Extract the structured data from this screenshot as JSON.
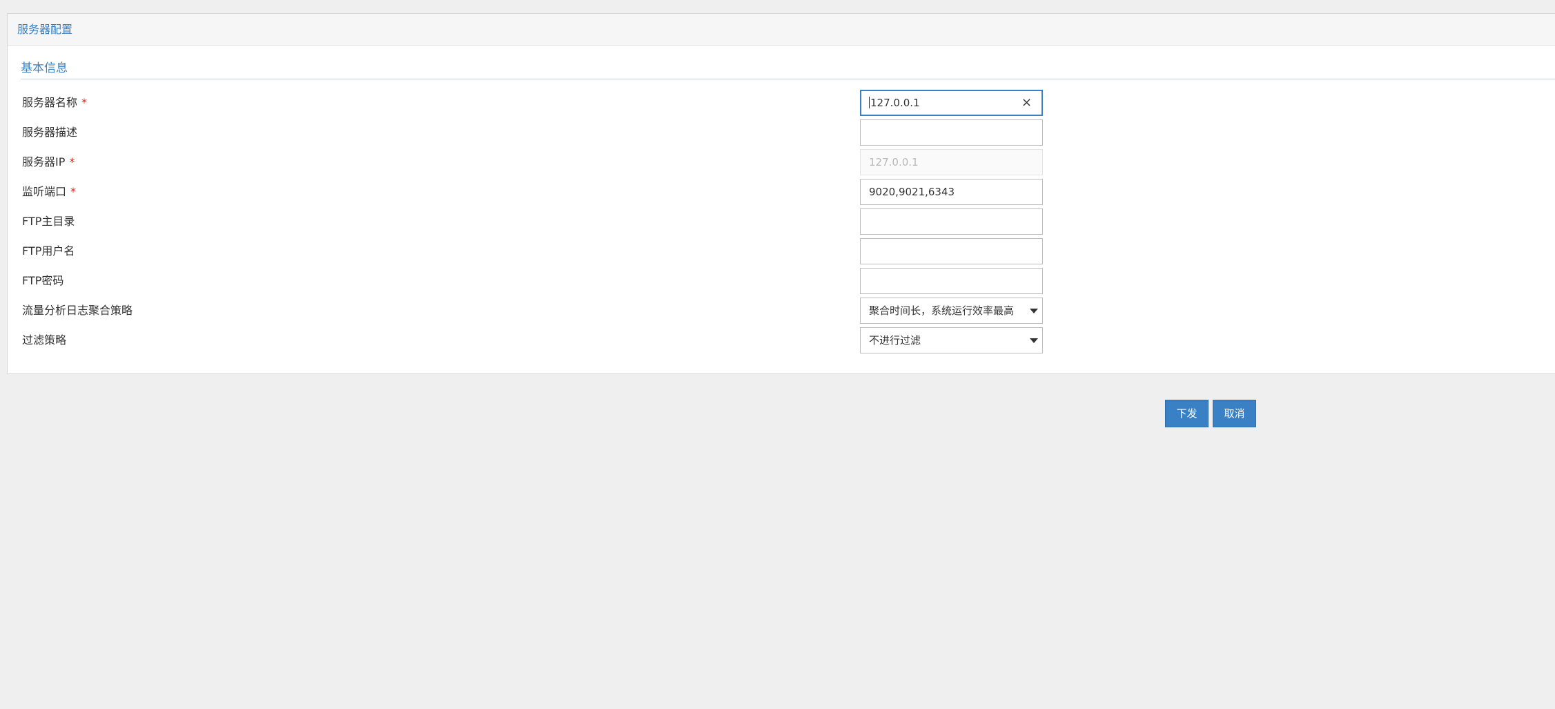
{
  "panel": {
    "title": "服务器配置",
    "section_title": "基本信息"
  },
  "form": {
    "server_name": {
      "label": "服务器名称",
      "required": "*",
      "value": "127.0.0.1"
    },
    "server_desc": {
      "label": "服务器描述",
      "value": ""
    },
    "server_ip": {
      "label": "服务器IP",
      "required": "*",
      "value": "127.0.0.1"
    },
    "listen_port": {
      "label": "监听端口",
      "required": "*",
      "value": "9020,9021,6343"
    },
    "ftp_dir": {
      "label": "FTP主目录",
      "value": ""
    },
    "ftp_user": {
      "label": "FTP用户名",
      "value": ""
    },
    "ftp_password": {
      "label": "FTP密码",
      "value": ""
    },
    "log_strategy": {
      "label": "流量分析日志聚合策略",
      "selected": "聚合时间长，系统运行效率最高"
    },
    "filter_strategy": {
      "label": "过滤策略",
      "selected": "不进行过滤"
    }
  },
  "buttons": {
    "submit": "下发",
    "cancel": "取消"
  },
  "icons": {
    "clear": "clear-icon",
    "dropdown": "chevron-down-icon"
  },
  "colors": {
    "accent": "#3a80c4",
    "required": "#e02424",
    "page_bg": "#efefef"
  }
}
